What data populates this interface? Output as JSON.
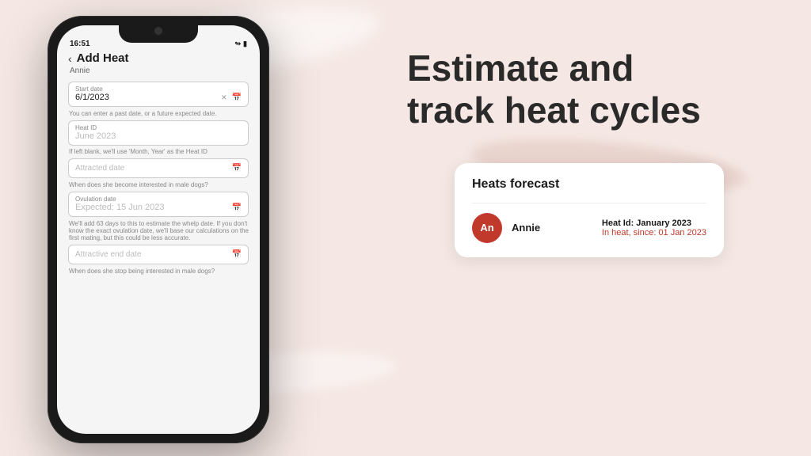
{
  "background": {
    "color": "#f5e8e4"
  },
  "phone": {
    "status_bar": {
      "time": "16:51",
      "wifi_icon": "wifi",
      "battery_icon": "battery"
    },
    "screen": {
      "header": {
        "back_label": "‹",
        "title": "Add Heat",
        "subtitle": "Annie"
      },
      "start_date_label": "Start date",
      "start_date_value": "6/1/2023",
      "start_date_hint": "You can enter a past date, or a future expected date.",
      "heat_id_label": "Heat ID",
      "heat_id_placeholder": "June 2023",
      "heat_id_hint": "If left blank, we'll use 'Month, Year' as the Heat ID",
      "attracted_date_label": "Attracted date",
      "attracted_date_hint": "When does she become interested in male dogs?",
      "ovulation_date_label": "Ovulation date",
      "ovulation_date_placeholder": "Expected: 15 Jun 2023",
      "ovulation_date_hint": "We'll add 63 days to this to estimate the whelp date. If you don't know the exact ovulation date, we'll base our calculations on the first mating, but this could be less accurate.",
      "attractive_end_label": "Attractive end date",
      "attractive_end_hint": "When does she stop being interested in male dogs?"
    }
  },
  "hero": {
    "line1": "Estimate and",
    "line2": "track heat cycles"
  },
  "forecast_card": {
    "title": "Heats forecast",
    "avatar_initials": "An",
    "avatar_color": "#c0392b",
    "dog_name": "Annie",
    "heat_id_label": "Heat Id: January 2023",
    "status": "In heat, since: 01 Jan 2023"
  }
}
